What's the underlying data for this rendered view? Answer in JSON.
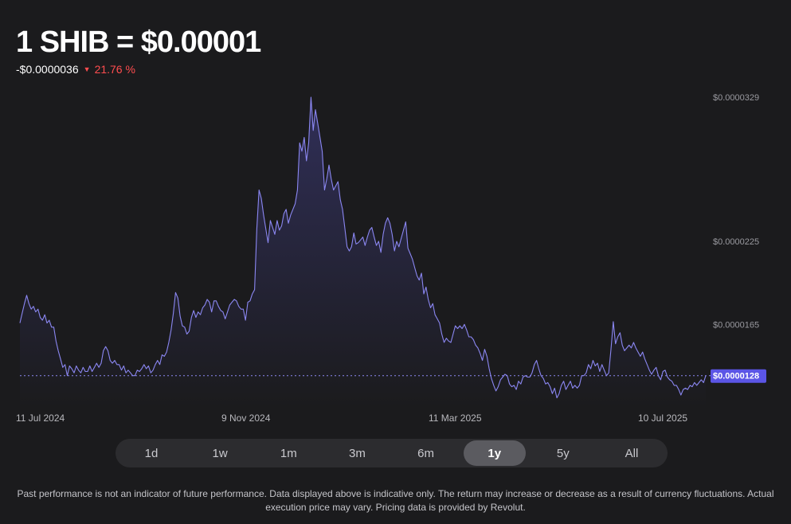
{
  "header": {
    "title": "1 SHIB = $0.00001",
    "change_abs": "-$0.0000036",
    "change_pct": "21.76 %",
    "direction_icon": "down-triangle-icon"
  },
  "range": {
    "options": [
      "1d",
      "1w",
      "1m",
      "3m",
      "6m",
      "1y",
      "5y",
      "All"
    ],
    "active": "1y"
  },
  "disclaimer": "Past performance is not an indicator of future performance. Data displayed above is indicative only. The return may increase or decrease as a result of currency fluctuations. Actual execution price may vary. Pricing data is provided by Revolut.",
  "colors": {
    "line": "#8b87f2",
    "current_badge": "#5b55e6",
    "negative": "#ff4d4f",
    "background": "#1b1b1d"
  },
  "chart_data": {
    "type": "line",
    "title": "",
    "xlabel": "",
    "ylabel": "",
    "x_tick_labels": [
      "11 Jul 2024",
      "9 Nov 2024",
      "11 Mar 2025",
      "10 Jul 2025"
    ],
    "y_tick_labels": [
      "$0.0000329",
      "$0.0000225",
      "$0.0000165"
    ],
    "current_value_label": "$0.0000128",
    "current_value": 1.28e-05,
    "ylim": [
      1.06e-05,
      3.29e-05
    ],
    "grid": false,
    "series": [
      {
        "values": [
          1.66e-05,
          1.73e-05,
          1.8e-05,
          1.86e-05,
          1.8e-05,
          1.76e-05,
          1.78e-05,
          1.74e-05,
          1.76e-05,
          1.7e-05,
          1.68e-05,
          1.72e-05,
          1.66e-05,
          1.68e-05,
          1.63e-05,
          1.63e-05,
          1.53e-05,
          1.46e-05,
          1.4e-05,
          1.34e-05,
          1.36e-05,
          1.28e-05,
          1.35e-05,
          1.33e-05,
          1.3e-05,
          1.35e-05,
          1.32e-05,
          1.3e-05,
          1.34e-05,
          1.31e-05,
          1.31e-05,
          1.35e-05,
          1.31e-05,
          1.34e-05,
          1.37e-05,
          1.34e-05,
          1.37e-05,
          1.46e-05,
          1.49e-05,
          1.46e-05,
          1.39e-05,
          1.37e-05,
          1.39e-05,
          1.36e-05,
          1.36e-05,
          1.32e-05,
          1.35e-05,
          1.3e-05,
          1.32e-05,
          1.3e-05,
          1.28e-05,
          1.28e-05,
          1.32e-05,
          1.31e-05,
          1.33e-05,
          1.36e-05,
          1.33e-05,
          1.35e-05,
          1.3e-05,
          1.32e-05,
          1.36e-05,
          1.39e-05,
          1.36e-05,
          1.43e-05,
          1.42e-05,
          1.45e-05,
          1.52e-05,
          1.61e-05,
          1.73e-05,
          1.88e-05,
          1.84e-05,
          1.71e-05,
          1.64e-05,
          1.63e-05,
          1.58e-05,
          1.6e-05,
          1.7e-05,
          1.75e-05,
          1.7e-05,
          1.74e-05,
          1.72e-05,
          1.77e-05,
          1.79e-05,
          1.83e-05,
          1.81e-05,
          1.74e-05,
          1.82e-05,
          1.82e-05,
          1.78e-05,
          1.75e-05,
          1.74e-05,
          1.69e-05,
          1.74e-05,
          1.79e-05,
          1.81e-05,
          1.83e-05,
          1.82e-05,
          1.78e-05,
          1.76e-05,
          1.76e-05,
          1.68e-05,
          1.81e-05,
          1.82e-05,
          1.87e-05,
          1.9e-05,
          2.34e-05,
          2.62e-05,
          2.56e-05,
          2.44e-05,
          2.34e-05,
          2.24e-05,
          2.4e-05,
          2.35e-05,
          2.3e-05,
          2.4e-05,
          2.33e-05,
          2.36e-05,
          2.45e-05,
          2.48e-05,
          2.38e-05,
          2.44e-05,
          2.48e-05,
          2.52e-05,
          2.62e-05,
          2.96e-05,
          2.9e-05,
          3e-05,
          2.83e-05,
          2.96e-05,
          3.29e-05,
          3.05e-05,
          3.2e-05,
          3.1e-05,
          3e-05,
          2.9e-05,
          2.62e-05,
          2.7e-05,
          2.8e-05,
          2.7e-05,
          2.62e-05,
          2.65e-05,
          2.68e-05,
          2.55e-05,
          2.48e-05,
          2.35e-05,
          2.21e-05,
          2.18e-05,
          2.21e-05,
          2.31e-05,
          2.23e-05,
          2.24e-05,
          2.26e-05,
          2.28e-05,
          2.22e-05,
          2.28e-05,
          2.33e-05,
          2.35e-05,
          2.28e-05,
          2.22e-05,
          2.25e-05,
          2.17e-05,
          2.3e-05,
          2.38e-05,
          2.42e-05,
          2.38e-05,
          2.3e-05,
          2.18e-05,
          2.25e-05,
          2.21e-05,
          2.27e-05,
          2.33e-05,
          2.39e-05,
          2.2e-05,
          2.16e-05,
          2.12e-05,
          2.06e-05,
          2e-05,
          1.97e-05,
          2.02e-05,
          1.87e-05,
          1.92e-05,
          1.83e-05,
          1.77e-05,
          1.8e-05,
          1.72e-05,
          1.69e-05,
          1.66e-05,
          1.58e-05,
          1.52e-05,
          1.55e-05,
          1.53e-05,
          1.52e-05,
          1.58e-05,
          1.64e-05,
          1.62e-05,
          1.64e-05,
          1.62e-05,
          1.65e-05,
          1.61e-05,
          1.56e-05,
          1.56e-05,
          1.54e-05,
          1.5e-05,
          1.48e-05,
          1.44e-05,
          1.39e-05,
          1.47e-05,
          1.42e-05,
          1.33e-05,
          1.26e-05,
          1.21e-05,
          1.17e-05,
          1.2e-05,
          1.25e-05,
          1.27e-05,
          1.29e-05,
          1.28e-05,
          1.22e-05,
          1.2e-05,
          1.21e-05,
          1.18e-05,
          1.24e-05,
          1.22e-05,
          1.27e-05,
          1.28e-05,
          1.27e-05,
          1.27e-05,
          1.3e-05,
          1.36e-05,
          1.39e-05,
          1.33e-05,
          1.28e-05,
          1.26e-05,
          1.22e-05,
          1.23e-05,
          1.2e-05,
          1.15e-05,
          1.19e-05,
          1.12e-05,
          1.15e-05,
          1.21e-05,
          1.24e-05,
          1.18e-05,
          1.21e-05,
          1.24e-05,
          1.19e-05,
          1.21e-05,
          1.19e-05,
          1.21e-05,
          1.28e-05,
          1.28e-05,
          1.3e-05,
          1.36e-05,
          1.33e-05,
          1.39e-05,
          1.35e-05,
          1.37e-05,
          1.31e-05,
          1.36e-05,
          1.32e-05,
          1.28e-05,
          1.3e-05,
          1.47e-05,
          1.67e-05,
          1.51e-05,
          1.56e-05,
          1.59e-05,
          1.5e-05,
          1.46e-05,
          1.48e-05,
          1.5e-05,
          1.48e-05,
          1.52e-05,
          1.48e-05,
          1.45e-05,
          1.42e-05,
          1.45e-05,
          1.4e-05,
          1.36e-05,
          1.32e-05,
          1.29e-05,
          1.32e-05,
          1.34e-05,
          1.28e-05,
          1.25e-05,
          1.31e-05,
          1.32e-05,
          1.27e-05,
          1.25e-05,
          1.24e-05,
          1.21e-05,
          1.21e-05,
          1.18e-05,
          1.14e-05,
          1.18e-05,
          1.19e-05,
          1.18e-05,
          1.21e-05,
          1.2e-05,
          1.23e-05,
          1.21e-05,
          1.23e-05,
          1.25e-05,
          1.23e-05,
          1.28e-05
        ]
      }
    ]
  }
}
